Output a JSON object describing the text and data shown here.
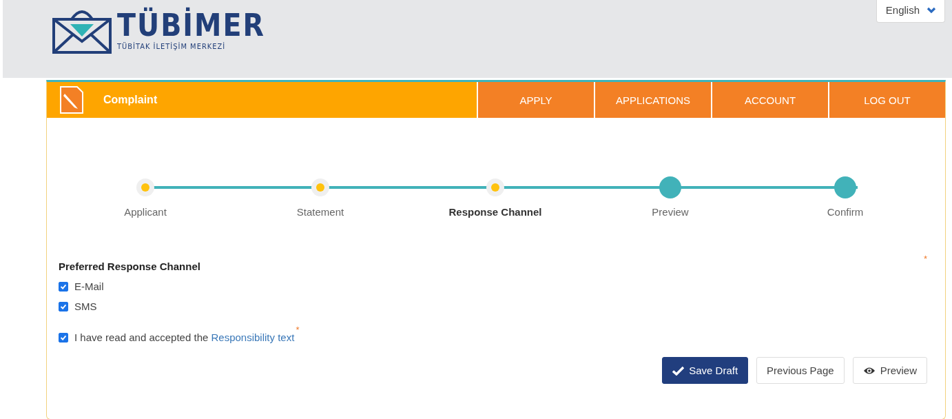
{
  "header": {
    "brand": "TÜBİMER",
    "subtitle": "TÜBİTAK İLETİŞİM MERKEZİ",
    "language": "English"
  },
  "nav": {
    "title": "Complaint",
    "items": [
      {
        "label": "APPLY"
      },
      {
        "label": "APPLICATIONS"
      },
      {
        "label": "ACCOUNT"
      },
      {
        "label": "LOG OUT"
      }
    ]
  },
  "steps": [
    {
      "label": "Applicant",
      "kind": "done",
      "selected": false
    },
    {
      "label": "Statement",
      "kind": "done",
      "selected": false
    },
    {
      "label": "Response Channel",
      "kind": "done",
      "selected": true
    },
    {
      "label": "Preview",
      "kind": "todo",
      "selected": false
    },
    {
      "label": "Confirm",
      "kind": "todo",
      "selected": false
    }
  ],
  "form": {
    "title": "Preferred Response Channel",
    "required_mark": "*",
    "options": [
      {
        "label": "E-Mail",
        "checked": true
      },
      {
        "label": "SMS",
        "checked": true
      }
    ],
    "consent": {
      "text": "I have read and accepted the",
      "link": "Responsibility text",
      "required_mark": "*",
      "checked": true
    }
  },
  "buttons": [
    {
      "label": "Save Draft",
      "kind": "primary"
    },
    {
      "label": "Previous Page",
      "kind": "plain"
    },
    {
      "label": "Preview",
      "kind": "preview"
    }
  ]
}
